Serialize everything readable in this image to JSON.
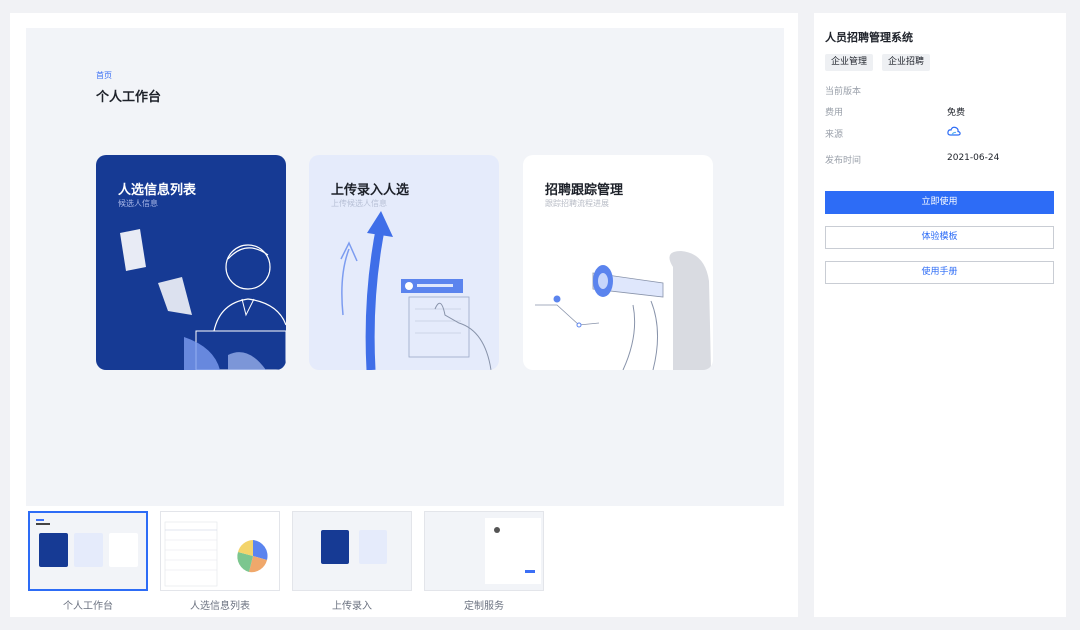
{
  "preview": {
    "breadcrumb": "首页",
    "title": "个人工作台",
    "cards": [
      {
        "title": "人选信息列表",
        "subtitle": "候选人信息"
      },
      {
        "title": "上传录入人选",
        "subtitle": "上传候选人信息"
      },
      {
        "title": "招聘跟踪管理",
        "subtitle": "跟踪招聘流程进展"
      }
    ]
  },
  "thumbnails": [
    {
      "label": "个人工作台",
      "active": true
    },
    {
      "label": "人选信息列表",
      "active": false
    },
    {
      "label": "上传录入",
      "active": false
    },
    {
      "label": "定制服务",
      "active": false
    }
  ],
  "details": {
    "title": "人员招聘管理系统",
    "tags": [
      "企业管理",
      "企业招聘"
    ],
    "version_label": "当前版本",
    "fee_label": "费用",
    "fee_value": "免费",
    "source_label": "来源",
    "source_icon": "cloud-icon",
    "publish_label": "发布时间",
    "publish_value": "2021-06-24",
    "buttons": {
      "use_now": "立即使用",
      "try_template": "体验模板",
      "manual": "使用手册"
    }
  },
  "colors": {
    "accent": "#2d6cf6",
    "card_dark": "#163a94",
    "card_light": "#e5ebfb"
  }
}
